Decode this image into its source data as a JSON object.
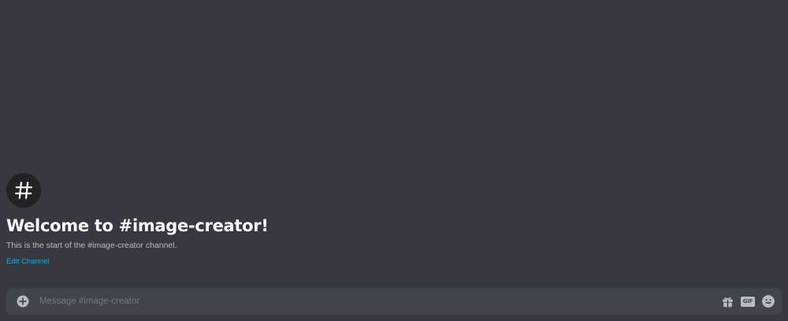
{
  "channel": {
    "hash_symbol": "#",
    "welcome_title": "Welcome to #image-creator!",
    "welcome_subtitle": "This is the start of the #image-creator channel.",
    "edit_link": "Edit Channel"
  },
  "composer": {
    "placeholder": "Message #image-creator",
    "value": "",
    "gif_label": "GIF",
    "icons": [
      "plus-circle-icon",
      "gift-icon",
      "gif-icon",
      "emoji-icon"
    ]
  },
  "colors": {
    "background": "#36393f",
    "composer_background": "#40444b",
    "hash_circle": "#202225",
    "title": "#ffffff",
    "subtitle": "#b9bbbe",
    "link": "#00aff4",
    "placeholder": "#72767d",
    "icon": "#b9bbbe"
  }
}
